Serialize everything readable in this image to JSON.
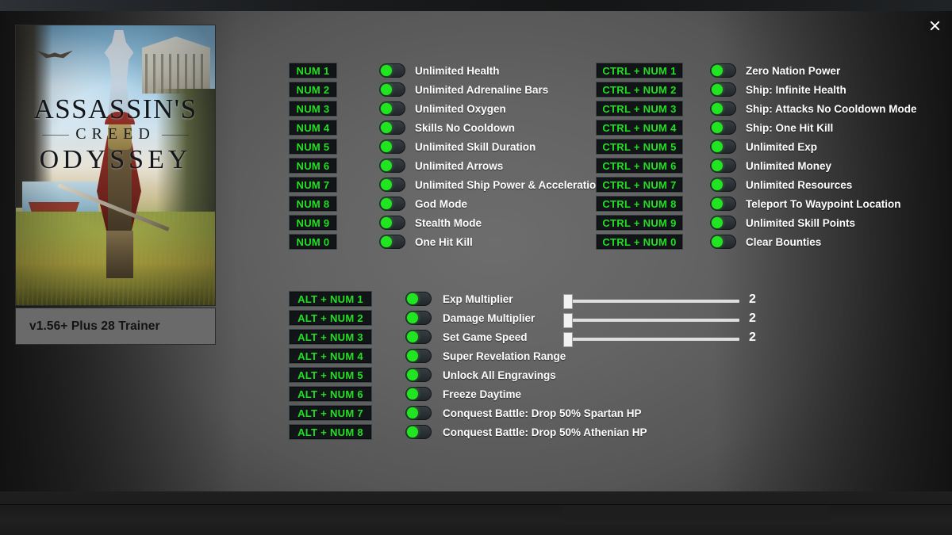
{
  "window": {
    "close_icon": "close-icon"
  },
  "cover": {
    "title_line1": "ASSASSIN'S",
    "title_line2": "CREED",
    "title_line3": "ODYSSEY",
    "version_label": "v1.56+ Plus 28 Trainer"
  },
  "colors": {
    "hotkey_text": "#21e021",
    "toggle_knob": "#22e522",
    "label_text": "#ffffff",
    "panel_bg": "#636363",
    "hotkey_bg": "#121517",
    "slider_track": "#dedede"
  },
  "columns": {
    "left": [
      {
        "hotkey": "NUM 1",
        "label": "Unlimited Health",
        "toggle": "off"
      },
      {
        "hotkey": "NUM 2",
        "label": "Unlimited  Adrenaline Bars",
        "toggle": "off"
      },
      {
        "hotkey": "NUM 3",
        "label": "Unlimited  Oxygen",
        "toggle": "off"
      },
      {
        "hotkey": "NUM 4",
        "label": "Skills No Cooldown",
        "toggle": "off"
      },
      {
        "hotkey": "NUM 5",
        "label": "Unlimited Skill Duration",
        "toggle": "off"
      },
      {
        "hotkey": "NUM 6",
        "label": "Unlimited Arrows",
        "toggle": "off"
      },
      {
        "hotkey": "NUM 7",
        "label": "Unlimited Ship Power & Acceleration",
        "toggle": "off"
      },
      {
        "hotkey": "NUM 8",
        "label": "God Mode",
        "toggle": "off"
      },
      {
        "hotkey": "NUM 9",
        "label": "Stealth Mode",
        "toggle": "off"
      },
      {
        "hotkey": "NUM 0",
        "label": "One Hit Kill",
        "toggle": "off"
      }
    ],
    "right": [
      {
        "hotkey": "CTRL + NUM 1",
        "label": "Zero Nation Power",
        "toggle": "off"
      },
      {
        "hotkey": "CTRL + NUM 2",
        "label": "Ship: Infinite Health",
        "toggle": "off"
      },
      {
        "hotkey": "CTRL + NUM 3",
        "label": "Ship: Attacks No Cooldown Mode",
        "toggle": "off"
      },
      {
        "hotkey": "CTRL + NUM 4",
        "label": "Ship: One Hit Kill",
        "toggle": "off"
      },
      {
        "hotkey": "CTRL + NUM 5",
        "label": "Unlimited Exp",
        "toggle": "off"
      },
      {
        "hotkey": "CTRL + NUM 6",
        "label": "Unlimited Money",
        "toggle": "off"
      },
      {
        "hotkey": "CTRL + NUM 7",
        "label": "Unlimited Resources",
        "toggle": "off"
      },
      {
        "hotkey": "CTRL + NUM 8",
        "label": "Teleport To Waypoint Location",
        "toggle": "off"
      },
      {
        "hotkey": "CTRL + NUM 9",
        "label": "Unlimited Skill Points",
        "toggle": "off"
      },
      {
        "hotkey": "CTRL + NUM 0",
        "label": "Clear Bounties",
        "toggle": "off"
      }
    ],
    "bottom": [
      {
        "hotkey": "ALT + NUM 1",
        "label": "Exp Multiplier",
        "toggle": "off",
        "slider": {
          "value": "2",
          "position_pct": 0
        }
      },
      {
        "hotkey": "ALT + NUM 2",
        "label": "Damage Multiplier",
        "toggle": "off",
        "slider": {
          "value": "2",
          "position_pct": 0
        }
      },
      {
        "hotkey": "ALT + NUM 3",
        "label": "Set Game Speed",
        "toggle": "off",
        "slider": {
          "value": "2",
          "position_pct": 0
        }
      },
      {
        "hotkey": "ALT + NUM 4",
        "label": "Super Revelation Range",
        "toggle": "off"
      },
      {
        "hotkey": "ALT + NUM 5",
        "label": "Unlock All Engravings",
        "toggle": "off"
      },
      {
        "hotkey": "ALT + NUM 6",
        "label": "Freeze Daytime",
        "toggle": "off"
      },
      {
        "hotkey": "ALT + NUM 7",
        "label": "Conquest Battle: Drop 50% Spartan HP",
        "toggle": "off"
      },
      {
        "hotkey": "ALT + NUM 8",
        "label": "Conquest Battle: Drop 50% Athenian HP",
        "toggle": "off"
      }
    ]
  }
}
